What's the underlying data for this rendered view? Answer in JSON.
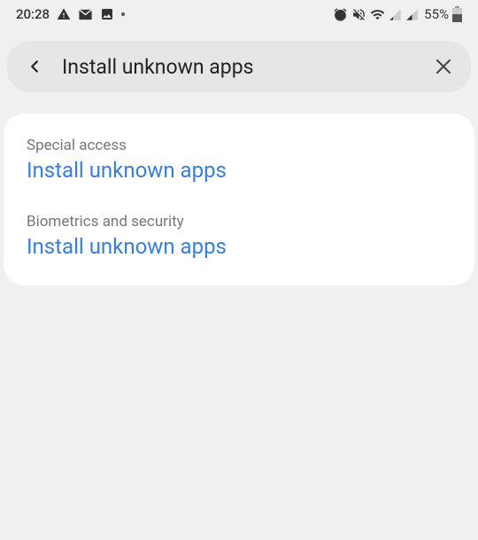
{
  "statusBar": {
    "time": "20:28",
    "battery": "55%"
  },
  "header": {
    "title": "Install unknown apps"
  },
  "results": [
    {
      "category": "Special access",
      "title": "Install unknown apps"
    },
    {
      "category": "Biometrics and security",
      "title": "Install unknown apps"
    }
  ]
}
